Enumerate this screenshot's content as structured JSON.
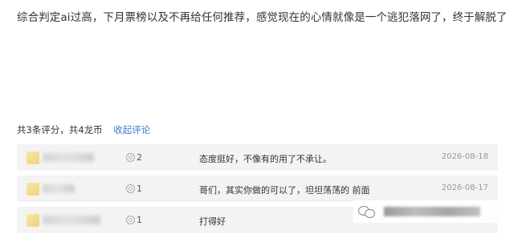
{
  "post": {
    "text": "综合判定ai过高，下月票榜以及不再给任何推荐，感觉现在的心情就像是一个逃犯落网了，终于解脱了"
  },
  "ratings": {
    "summary": "共3条评分，共4龙币",
    "collapse_label": "收起评论",
    "rows": [
      {
        "count": "2",
        "comment": "态度挺好，不像有的用了不承让。",
        "date": "2026-08-18"
      },
      {
        "count": "1",
        "comment": "哥们，其实你做的可以了，坦坦荡荡的 前面",
        "date": "2026-08-17"
      },
      {
        "count": "1",
        "comment": "打得好",
        "date": ""
      }
    ]
  },
  "icons": {
    "coin": "coin-icon",
    "watermark_logo": "wechat-icon"
  },
  "colors": {
    "link": "#3a7bd5",
    "row_bg": "#f3f3f3",
    "date": "#999999"
  }
}
